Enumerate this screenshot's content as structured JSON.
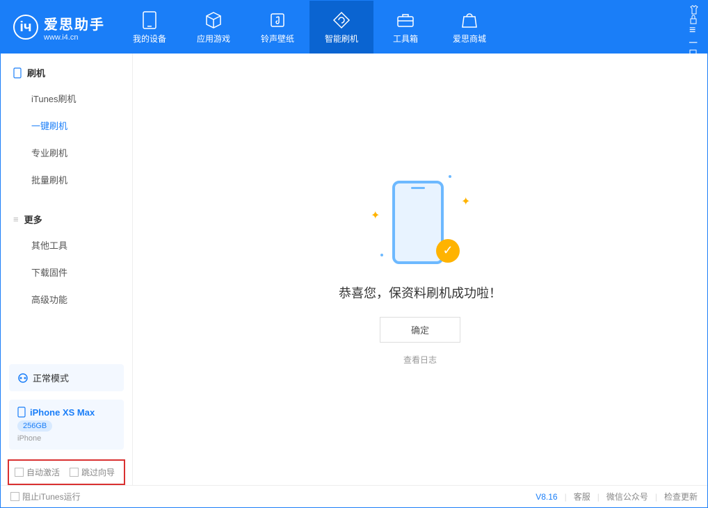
{
  "app": {
    "title": "爱思助手",
    "subtitle": "www.i4.cn"
  },
  "nav": {
    "my_device": "我的设备",
    "apps_games": "应用游戏",
    "ringtones": "铃声壁纸",
    "smart_flash": "智能刷机",
    "toolbox": "工具箱",
    "store": "爱思商城"
  },
  "sidebar": {
    "group1_title": "刷机",
    "g1_items": [
      "iTunes刷机",
      "一键刷机",
      "专业刷机",
      "批量刷机"
    ],
    "group2_title": "更多",
    "g2_items": [
      "其他工具",
      "下载固件",
      "高级功能"
    ]
  },
  "device_mode": {
    "label": "正常模式"
  },
  "device_info": {
    "name": "iPhone XS Max",
    "capacity": "256GB",
    "type": "iPhone"
  },
  "options": {
    "auto_activate": "自动激活",
    "skip_guide": "跳过向导"
  },
  "main": {
    "success_text": "恭喜您，保资料刷机成功啦！",
    "ok_button": "确定",
    "view_log": "查看日志"
  },
  "statusbar": {
    "block_itunes": "阻止iTunes运行",
    "version": "V8.16",
    "service": "客服",
    "wechat": "微信公众号",
    "check_update": "检查更新"
  }
}
